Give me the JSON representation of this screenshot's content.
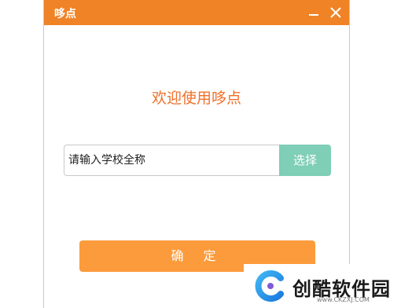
{
  "window": {
    "title": "哆点",
    "accent_color": "#f08326"
  },
  "main": {
    "welcome_text": "欢迎使用哆点",
    "school_input": {
      "placeholder": "请输入学校全称",
      "value": ""
    },
    "select_label": "选择",
    "confirm_label": "确 定"
  },
  "watermark": {
    "brand": "创酷软件园",
    "url": "www.CKZXJ.COM",
    "icon": "c-logo-icon"
  }
}
